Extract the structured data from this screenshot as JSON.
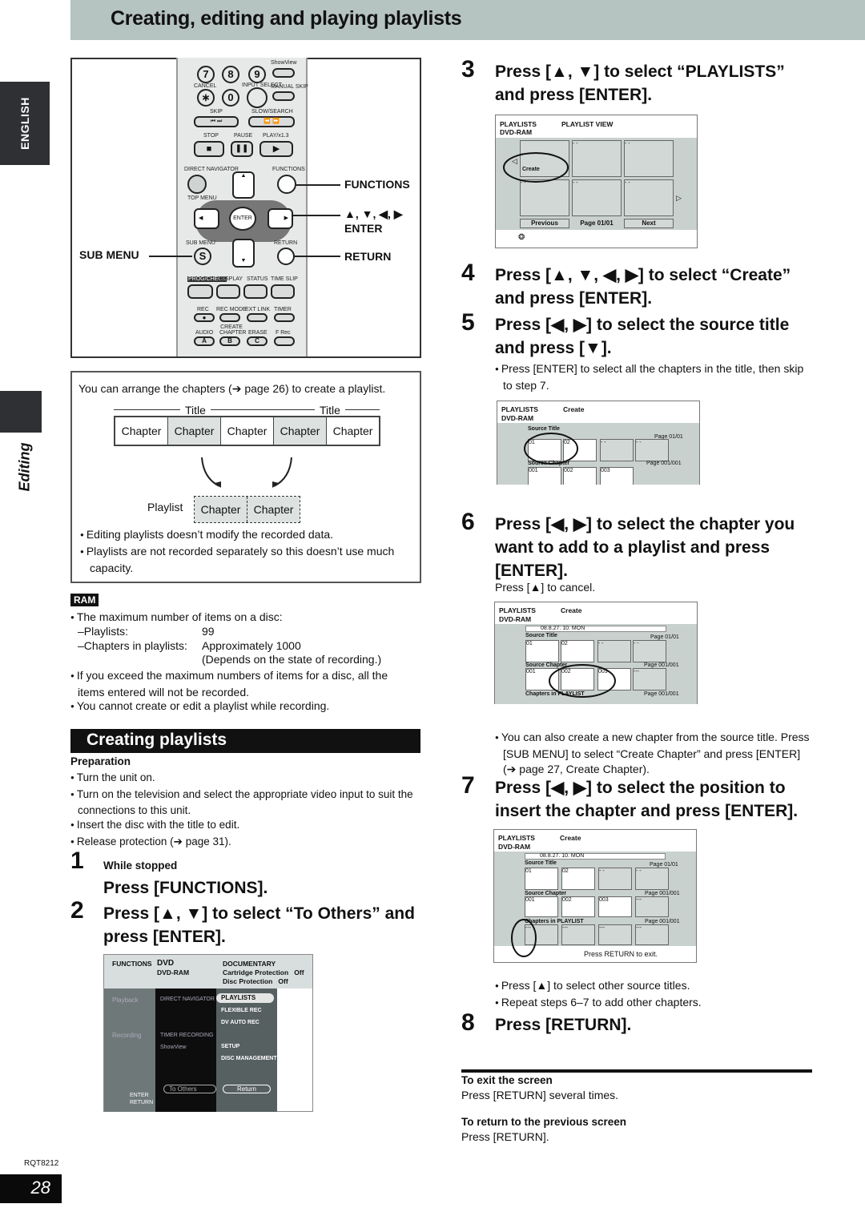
{
  "page": {
    "title": "Creating, editing and playing playlists",
    "language_tab": "ENGLISH",
    "section_label": "Editing",
    "doc_code": "RQT8212",
    "page_number": "28"
  },
  "remote": {
    "buttons": {
      "num7": "7",
      "num8": "8",
      "num9": "9",
      "showview": "ShowView",
      "cancel": "CANCEL",
      "star": "∗",
      "num0": "0",
      "input_select": "INPUT SELECT",
      "manual_skip": "MANUAL SKIP",
      "skip": "SKIP",
      "slow_search": "SLOW/SEARCH",
      "stop": "STOP",
      "pause": "PAUSE",
      "play": "PLAY/x1.3",
      "direct_navigator": "DIRECT NAVIGATOR",
      "functions": "FUNCTIONS",
      "top_menu": "TOP MENU",
      "enter": "ENTER",
      "sub_menu": "SUB MENU",
      "sub_menu_glyph": "S",
      "return": "RETURN",
      "prog_check": "PROG/CHECK",
      "display": "DISPLAY",
      "status": "STATUS",
      "time_slip": "TIME SLIP",
      "rec": "REC",
      "rec_mode": "REC MODE",
      "ext_link": "EXT LINK",
      "timer": "TIMER",
      "audio": "AUDIO",
      "create_chapter": "CREATE CHAPTER",
      "erase": "ERASE",
      "f_rec": "F Rec",
      "a": "A",
      "b": "B",
      "c": "C"
    },
    "callouts": {
      "functions": "FUNCTIONS",
      "arrows": "▲, ▼, ◀, ▶",
      "enter": "ENTER",
      "sub_menu": "SUB MENU",
      "return": "RETURN"
    }
  },
  "intro": {
    "text": "You can arrange the chapters (➔ page 26) to create a playlist.",
    "title_label": "Title",
    "chapters": [
      "Chapter",
      "Chapter",
      "Chapter",
      "Chapter",
      "Chapter"
    ],
    "playlist_label": "Playlist",
    "playlist_chapters": [
      "Chapter",
      "Chapter"
    ],
    "notes": [
      "Editing playlists doesn’t modify the recorded data.",
      "Playlists are not recorded separately so this doesn’t use much capacity."
    ]
  },
  "ram": {
    "badge": "RAM",
    "max_items_intro": "The maximum number of items on a disc:",
    "playlists_label": "–Playlists:",
    "playlists_value": "99",
    "chapters_label": "–Chapters in playlists:",
    "chapters_value": "Approximately 1000",
    "chapters_note": "(Depends on the state of recording.)",
    "notes": [
      "If you exceed the maximum numbers of items for a disc, all the items entered will not be recorded.",
      "You cannot create or edit a playlist while recording."
    ]
  },
  "creating": {
    "heading": "Creating playlists",
    "preparation_label": "Preparation",
    "preparation": [
      "Turn the unit on.",
      "Turn on the television and select the appropriate video input to suit the connections to this unit.",
      "Insert the disc with the title to edit.",
      "Release protection (➔ page 31)."
    ]
  },
  "steps": [
    {
      "num": "1",
      "pre": "While stopped",
      "text": "Press [FUNCTIONS]."
    },
    {
      "num": "2",
      "text": "Press [▲, ▼] to select “To Others” and press [ENTER]."
    },
    {
      "num": "3",
      "text": "Press [▲, ▼] to select “PLAYLISTS” and press [ENTER]."
    },
    {
      "num": "4",
      "text": "Press [▲, ▼, ◀, ▶] to select “Create” and press [ENTER]."
    },
    {
      "num": "5",
      "text": "Press [◀, ▶] to select the source title and press [▼].",
      "note": "Press [ENTER] to select all the chapters in the title, then skip to step 7."
    },
    {
      "num": "6",
      "text": "Press [◀, ▶] to select the chapter you want to add to a playlist and press [ENTER].",
      "note": "Press [▲] to cancel."
    },
    {
      "num": "7",
      "text": "Press [◀, ▶] to select the position to insert the chapter and press [ENTER].",
      "pre_note": "You can also create a new chapter from the source title. Press [SUB MENU] to select “Create Chapter” and press [ENTER] (➔ page 27, Create Chapter).",
      "notes": [
        "Press [▲] to select other source titles.",
        "Repeat steps 6–7 to add other chapters."
      ]
    },
    {
      "num": "8",
      "text": "Press [RETURN]."
    }
  ],
  "functions_screen": {
    "label": "FUNCTIONS",
    "disc_type": "DVD",
    "disc_sub": "DVD-RAM",
    "title": "DOCUMENTARY",
    "cartridge_protection": "Cartridge Protection   Off",
    "disc_protection": "Disc Protection   Off",
    "left_labels": [
      "Playback",
      "Recording"
    ],
    "mid_items": [
      "DIRECT NAVIGATOR",
      "TIMER RECORDING",
      "ShowView"
    ],
    "right_items": [
      "PLAYLISTS",
      "FLEXIBLE REC",
      "DV AUTO REC",
      "SETUP",
      "DISC MANAGEMENT"
    ],
    "to_others": "To Others",
    "return": "Return",
    "legend_enter": "ENTER",
    "legend_return": "RETURN"
  },
  "playlist_view_screen": {
    "label": "PLAYLISTS",
    "mode": "PLAYLIST VIEW",
    "disc": "DVD-RAM",
    "create": "Create",
    "empty": "- -",
    "previous": "Previous",
    "page": "Page 01/01",
    "next": "Next"
  },
  "create_screens": {
    "label": "PLAYLISTS",
    "mode": "Create",
    "disc": "DVD-RAM",
    "date": "08.8.27. 10. MON",
    "source_title": "Source Title",
    "source_title_page": "Page 01/01",
    "source_chapter": "Source Chapter",
    "source_chapter_page": "Page 001/001",
    "chapters_in_playlist": "Chapters in PLAYLIST",
    "playlist_page": "Page 001/001",
    "titles": [
      "01",
      "02",
      "- -",
      "- -"
    ],
    "chapters": [
      "001",
      "002",
      "003",
      "---"
    ],
    "playlist_slots": [
      "---",
      "---",
      "---",
      "---"
    ],
    "exit_hint": "Press RETURN to exit."
  },
  "footer": {
    "exit_heading": "To exit the screen",
    "exit_text": "Press [RETURN] several times.",
    "prev_heading": "To return to the previous screen",
    "prev_text": "Press [RETURN]."
  }
}
